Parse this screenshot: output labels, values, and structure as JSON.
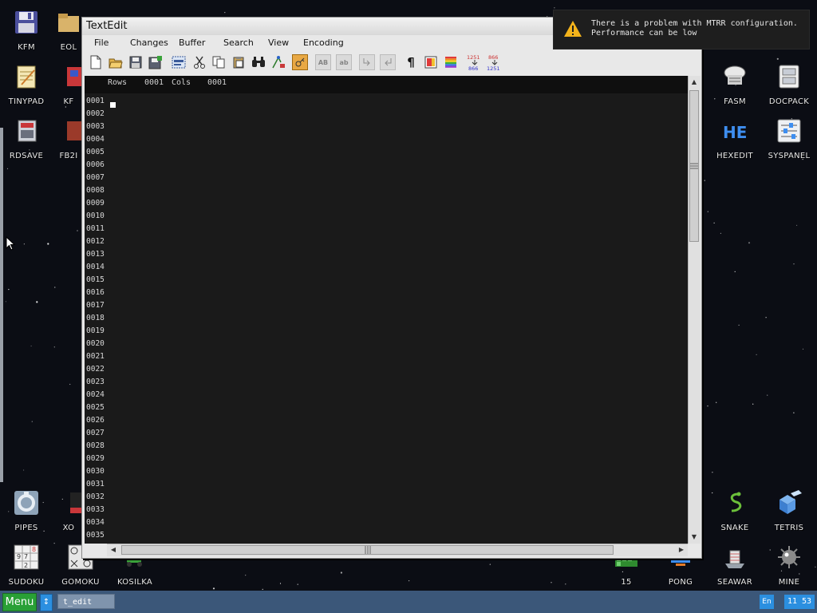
{
  "desktop": {
    "icons_left": [
      {
        "label": "KFM"
      },
      {
        "label": "EOL"
      },
      {
        "label": "TINYPAD"
      },
      {
        "label": "KF"
      },
      {
        "label": "RDSAVE"
      },
      {
        "label": "FB2I"
      },
      {
        "label": "PIPES"
      },
      {
        "label": "XO"
      },
      {
        "label": "SUDOKU"
      },
      {
        "label": "GOMOKU"
      },
      {
        "label": "KOSILKA"
      }
    ],
    "icons_right": [
      {
        "label": "FASM"
      },
      {
        "label": "DOCPACK"
      },
      {
        "label": "HEXEDIT"
      },
      {
        "label": "SYSPANEL"
      },
      {
        "label": "SNAKE"
      },
      {
        "label": "TETRIS"
      },
      {
        "label": "15"
      },
      {
        "label": "PONG"
      },
      {
        "label": "SEAWAR"
      },
      {
        "label": "MINE"
      }
    ],
    "sudoku_digits": [
      "9",
      "7",
      "8",
      "2"
    ],
    "hexedit_glyph": "HE"
  },
  "notification": {
    "line1": "There is a problem with MTRR configuration.",
    "line2": "Performance can be low",
    "icon": "warning-icon"
  },
  "window": {
    "title": "TextEdit",
    "menu": [
      "File",
      "Changes",
      "Buffer",
      "Search",
      "View",
      "Encoding"
    ],
    "toolbar": [
      {
        "name": "new-file-icon"
      },
      {
        "name": "open-folder-icon"
      },
      {
        "name": "save-icon"
      },
      {
        "name": "save-as-icon"
      },
      {
        "name": "select-all-icon"
      },
      {
        "name": "cut-icon"
      },
      {
        "name": "copy-icon"
      },
      {
        "name": "paste-icon"
      },
      {
        "name": "find-icon"
      },
      {
        "name": "goto-line-icon"
      },
      {
        "name": "key-icon"
      },
      {
        "name": "uppercase-icon",
        "text": "AB"
      },
      {
        "name": "lowercase-icon",
        "text": "ab"
      },
      {
        "name": "collapse-icon"
      },
      {
        "name": "expand-icon"
      },
      {
        "name": "show-symbols-icon",
        "text": "¶"
      },
      {
        "name": "color-scheme-icon"
      },
      {
        "name": "syntax-colors-icon"
      },
      {
        "name": "convert-1251-866-icon",
        "top": "1251",
        "bottom": "866"
      },
      {
        "name": "convert-866-1251-icon",
        "top": "866",
        "bottom": "1251"
      }
    ],
    "status": {
      "rows_label": "Rows",
      "rows_value": "0001",
      "cols_label": "Cols",
      "cols_value": "0001"
    },
    "line_numbers": [
      "0001",
      "0002",
      "0003",
      "0004",
      "0005",
      "0006",
      "0007",
      "0008",
      "0009",
      "0010",
      "0011",
      "0012",
      "0013",
      "0014",
      "0015",
      "0016",
      "0017",
      "0018",
      "0019",
      "0020",
      "0021",
      "0022",
      "0023",
      "0024",
      "0025",
      "0026",
      "0027",
      "0028",
      "0029",
      "0030",
      "0031",
      "0032",
      "0033",
      "0034",
      "0035"
    ]
  },
  "taskbar": {
    "menu_label": "Menu",
    "task_label": "t_edit",
    "lang": "En",
    "clock": "11 53"
  }
}
